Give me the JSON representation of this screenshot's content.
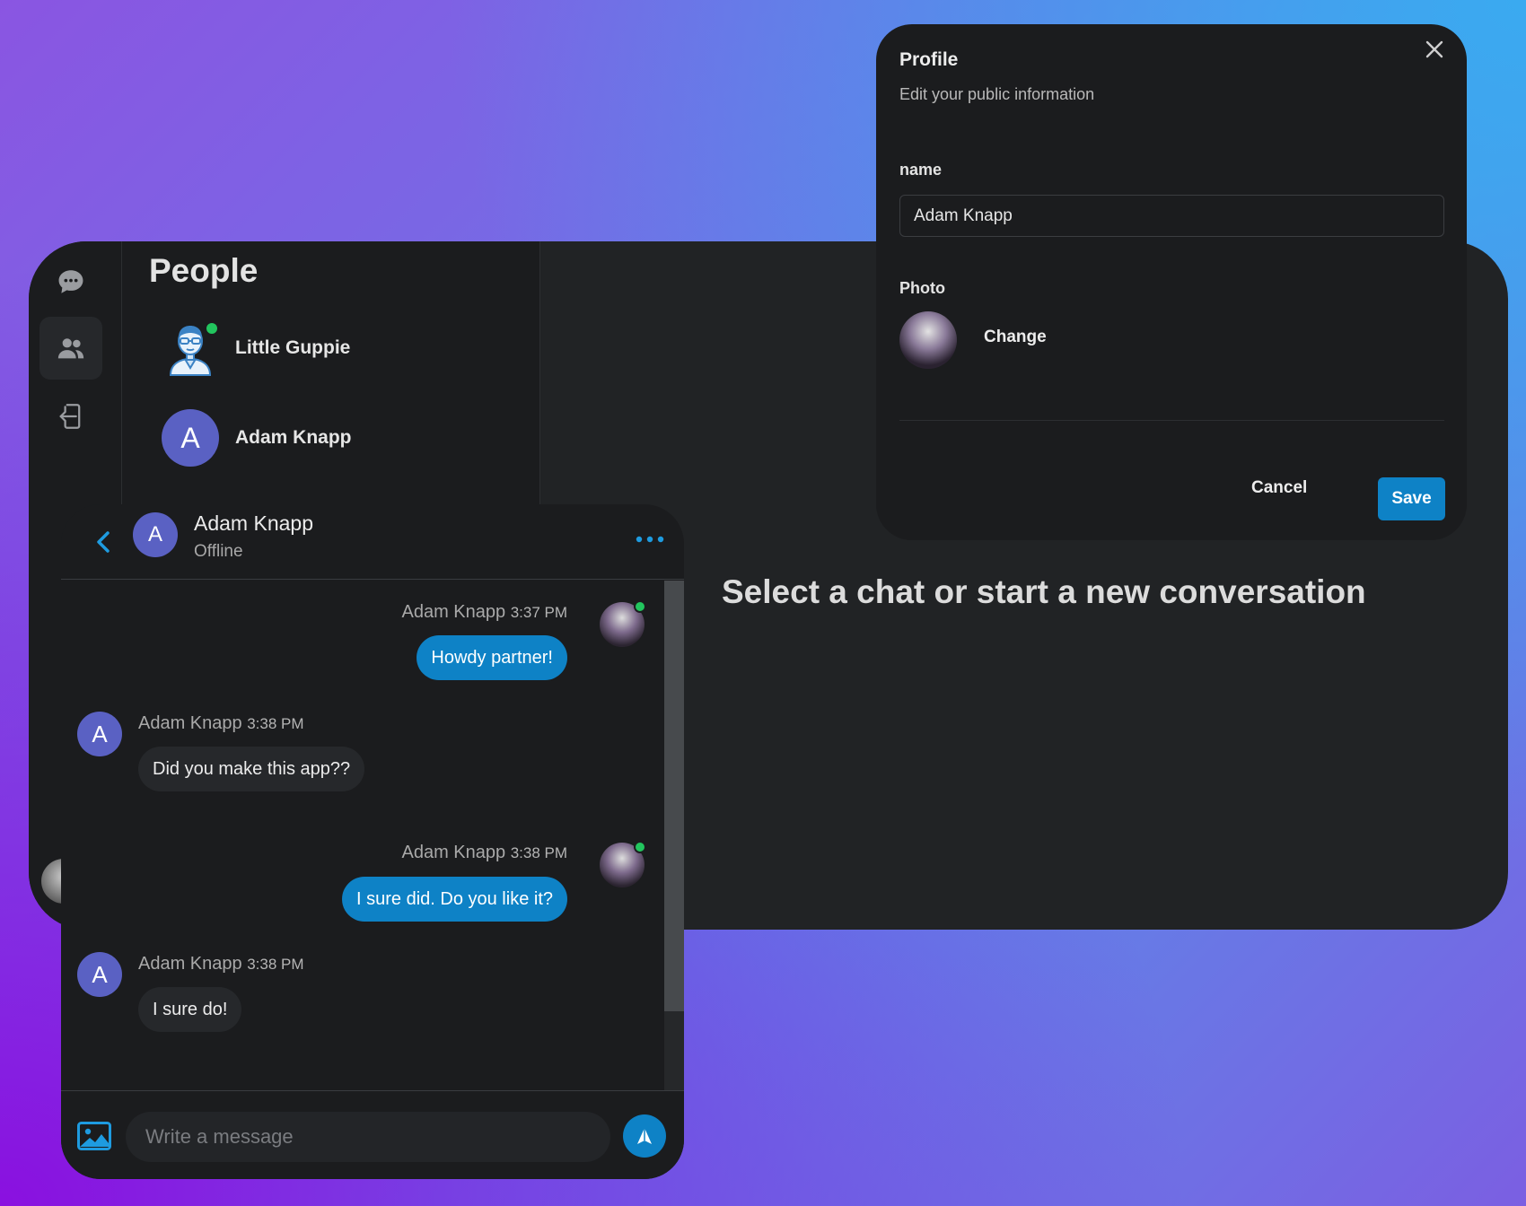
{
  "sidebar": {
    "items": [
      {
        "icon": "chat-bubble-icon"
      },
      {
        "icon": "people-icon"
      },
      {
        "icon": "logout-icon"
      }
    ]
  },
  "people_panel": {
    "title": "People",
    "people": [
      {
        "name": "Little Guppie",
        "avatar": "person-illustration",
        "online": true
      },
      {
        "name": "Adam Knapp",
        "avatar_letter": "A",
        "online": false
      }
    ]
  },
  "main": {
    "empty_message": "Select a chat or start a new conversation"
  },
  "chat": {
    "contact_name": "Adam Knapp",
    "contact_letter": "A",
    "contact_status": "Offline",
    "messages": [
      {
        "author": "Adam Knapp",
        "time": "3:37 PM",
        "text": "Howdy partner!",
        "mine": true
      },
      {
        "author": "Adam Knapp",
        "time": "3:38 PM",
        "text": "Did you make this app??",
        "mine": false
      },
      {
        "author": "Adam Knapp",
        "time": "3:38 PM",
        "text": "I sure did. Do you like it?",
        "mine": true
      },
      {
        "author": "Adam Knapp",
        "time": "3:38 PM",
        "text": "I sure do!",
        "mine": false
      }
    ],
    "composer_placeholder": "Write a message"
  },
  "profile_modal": {
    "title": "Profile",
    "subtitle": "Edit your public information",
    "name_label": "name",
    "name_value": "Adam Knapp",
    "photo_label": "Photo",
    "change_label": "Change",
    "cancel_label": "Cancel",
    "save_label": "Save"
  },
  "colors": {
    "accent": "#0e82c6",
    "avatar_letter_bg": "#5a61c3",
    "online": "#22c55e",
    "panel_bg": "#1b1c1e"
  }
}
